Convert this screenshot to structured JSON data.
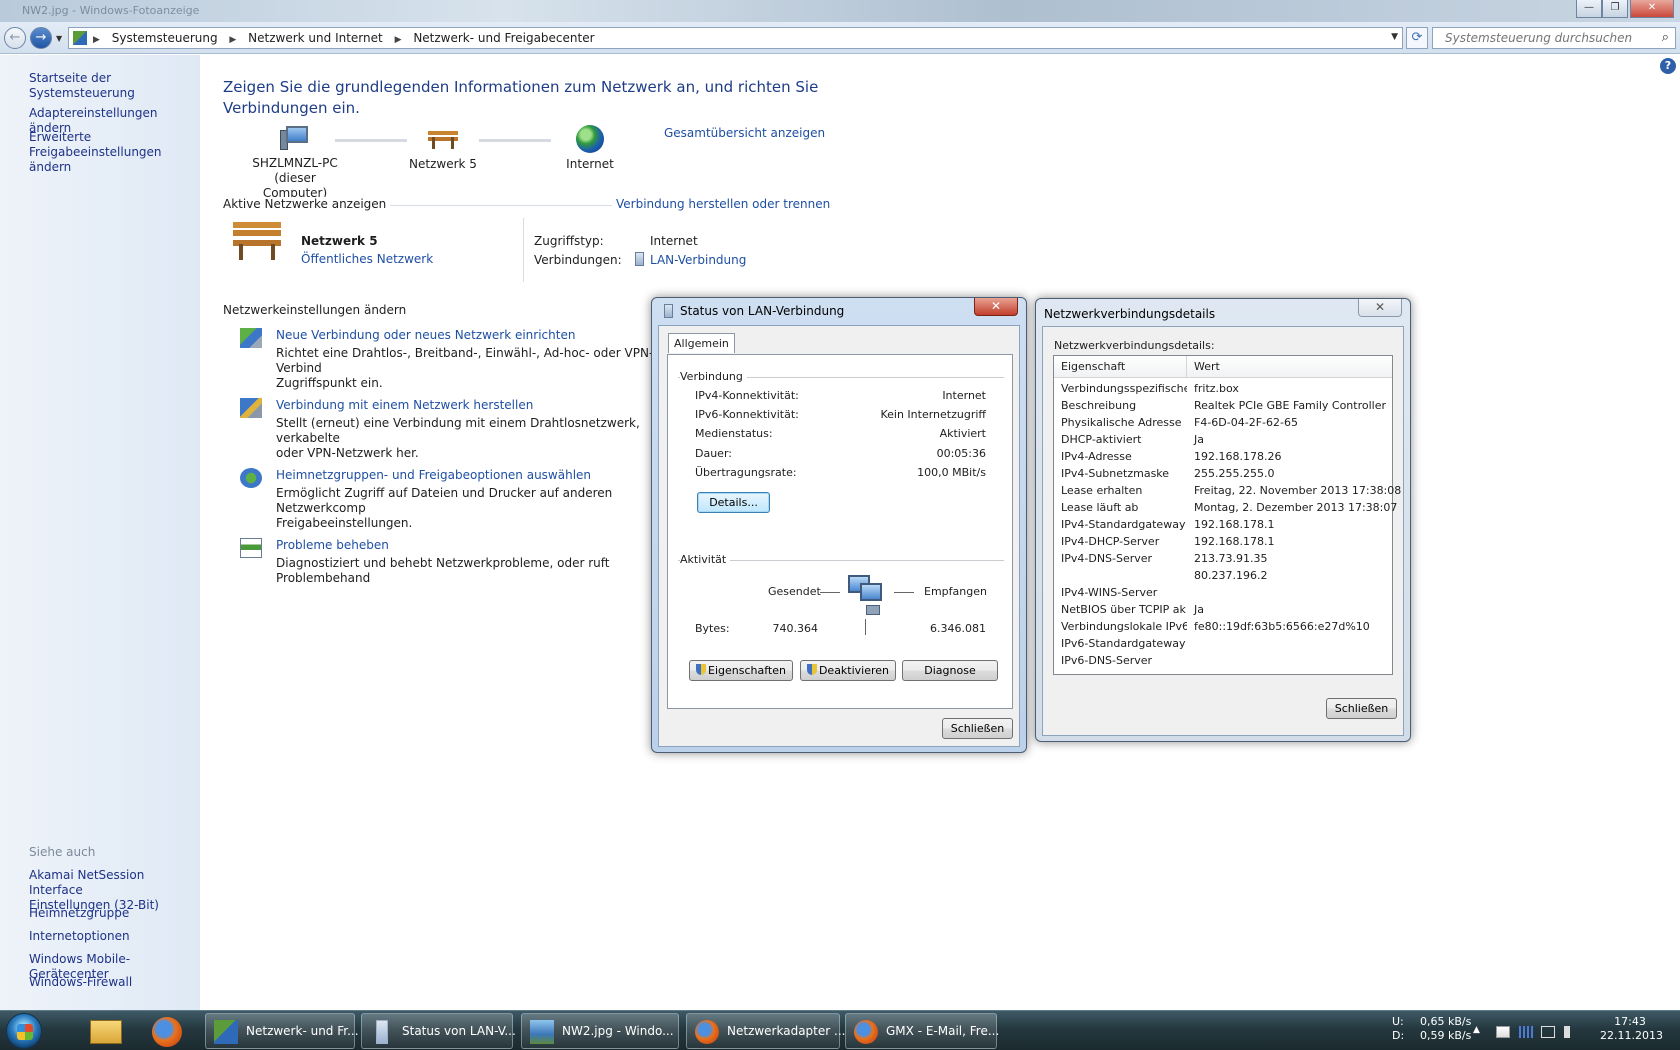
{
  "window": {
    "title": "NW2.jpg - Windows-Fotoanzeige",
    "minimize": "—",
    "maximize": "❐",
    "close": "✕"
  },
  "address": {
    "crumbs": [
      "Systemsteuerung",
      "Netzwerk und Internet",
      "Netzwerk- und Freigabecenter"
    ],
    "search_placeholder": "Systemsteuerung durchsuchen"
  },
  "left": {
    "home": "Startseite der Systemsteuerung",
    "adapter": "Adaptereinstellungen ändern",
    "advanced_1": "Erweiterte",
    "advanced_2": "Freigabeeinstellungen ändern",
    "see_also": "Siehe auch",
    "akamai_1": "Akamai NetSession Interface",
    "akamai_2": "Einstellungen (32-Bit)",
    "homegroup": "Heimnetzgruppe",
    "internet_options": "Internetoptionen",
    "mobile": "Windows Mobile-Gerätecenter",
    "firewall": "Windows-Firewall"
  },
  "main": {
    "title": "Zeigen Sie die grundlegenden Informationen zum Netzwerk an, und richten Sie Verbindungen ein.",
    "full_map": "Gesamtübersicht anzeigen",
    "node_pc_1": "SHZLMNZL-PC",
    "node_pc_2": "(dieser Computer)",
    "node_net": "Netzwerk  5",
    "node_internet": "Internet",
    "active_head": "Aktive Netzwerke anzeigen",
    "connect_link": "Verbindung herstellen oder trennen",
    "net_name": "Netzwerk  5",
    "net_type": "Öffentliches Netzwerk",
    "access_label": "Zugriffstyp:",
    "access_value": "Internet",
    "connections_label": "Verbindungen:",
    "connections_value": "LAN-Verbindung",
    "settings_head": "Netzwerkeinstellungen ändern",
    "tasks": [
      {
        "link": "Neue Verbindung oder neues Netzwerk einrichten",
        "desc": "Richtet eine Drahtlos-, Breitband-, Einwähl-, Ad-hoc- oder VPN-Verbind\nZugriffspunkt ein."
      },
      {
        "link": "Verbindung mit einem Netzwerk herstellen",
        "desc": "Stellt (erneut) eine Verbindung mit einem Drahtlosnetzwerk, verkabelte\noder VPN-Netzwerk her."
      },
      {
        "link": "Heimnetzgruppen- und Freigabeoptionen auswählen",
        "desc": "Ermöglicht Zugriff auf Dateien und Drucker auf anderen Netzwerkcomp\nFreigabeeinstellungen."
      },
      {
        "link": "Probleme beheben",
        "desc": "Diagnostiziert und behebt Netzwerkprobleme, oder ruft Problembehand"
      }
    ]
  },
  "status_dialog": {
    "title": "Status von LAN-Verbindung",
    "tab": "Allgemein",
    "group_conn": "Verbindung",
    "rows": [
      {
        "label": "IPv4-Konnektivität:",
        "value": "Internet"
      },
      {
        "label": "IPv6-Konnektivität:",
        "value": "Kein Internetzugriff"
      },
      {
        "label": "Medienstatus:",
        "value": "Aktiviert"
      },
      {
        "label": "Dauer:",
        "value": "00:05:36"
      },
      {
        "label": "Übertragungsrate:",
        "value": "100,0 MBit/s"
      }
    ],
    "details_btn": "Details...",
    "group_activity": "Aktivität",
    "sent": "Gesendet",
    "received": "Empfangen",
    "bytes_label": "Bytes:",
    "bytes_sent": "740.364",
    "bytes_received": "6.346.081",
    "btn_properties": "Eigenschaften",
    "btn_disable": "Deaktivieren",
    "btn_diagnose": "Diagnose",
    "btn_close": "Schließen"
  },
  "details_dialog": {
    "title": "Netzwerkverbindungsdetails",
    "label": "Netzwerkverbindungsdetails:",
    "col_prop": "Eigenschaft",
    "col_val": "Wert",
    "rows": [
      {
        "p": "Verbindungsspezifisches...",
        "v": "fritz.box"
      },
      {
        "p": "Beschreibung",
        "v": "Realtek PCIe GBE Family Controller"
      },
      {
        "p": "Physikalische Adresse",
        "v": "F4-6D-04-2F-62-65"
      },
      {
        "p": "DHCP-aktiviert",
        "v": "Ja"
      },
      {
        "p": "IPv4-Adresse",
        "v": "192.168.178.26"
      },
      {
        "p": "IPv4-Subnetzmaske",
        "v": "255.255.255.0"
      },
      {
        "p": "Lease erhalten",
        "v": "Freitag, 22. November 2013 17:38:08"
      },
      {
        "p": "Lease läuft ab",
        "v": "Montag, 2. Dezember 2013 17:38:07"
      },
      {
        "p": "IPv4-Standardgateway",
        "v": "192.168.178.1"
      },
      {
        "p": "IPv4-DHCP-Server",
        "v": "192.168.178.1"
      },
      {
        "p": "IPv4-DNS-Server",
        "v": "213.73.91.35"
      },
      {
        "p": "",
        "v": "80.237.196.2"
      },
      {
        "p": "IPv4-WINS-Server",
        "v": ""
      },
      {
        "p": "NetBIOS über TCPIP ak...",
        "v": "Ja"
      },
      {
        "p": "Verbindungslokale IPv6-...",
        "v": "fe80::19df:63b5:6566:e27d%10"
      },
      {
        "p": "IPv6-Standardgateway",
        "v": ""
      },
      {
        "p": "IPv6-DNS-Server",
        "v": ""
      }
    ],
    "btn_close": "Schließen"
  },
  "taskbar": {
    "items": [
      {
        "label": "Netzwerk- und Fr...",
        "icon": "network-icon"
      },
      {
        "label": "Status von LAN-V...",
        "icon": "lan-icon"
      },
      {
        "label": "NW2.jpg - Windo...",
        "icon": "photo-icon"
      },
      {
        "label": "Netzwerkadapter ...",
        "icon": "firefox-icon"
      },
      {
        "label": "GMX - E-Mail, Fre...",
        "icon": "firefox-icon"
      }
    ],
    "upload_label": "U:",
    "download_label": "D:",
    "upload": "0,65 kB/s",
    "download": "0,59 kB/s",
    "time": "17:43",
    "date": "22.11.2013"
  }
}
